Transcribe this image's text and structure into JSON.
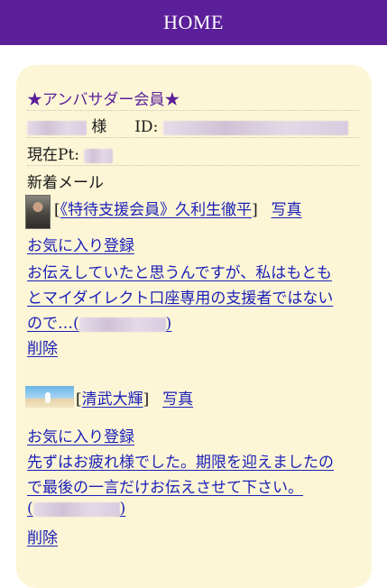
{
  "header": {
    "title": "HOME"
  },
  "profile": {
    "rank_label": "★アンバサダー会員★",
    "name_suffix": "様",
    "id_label": "ID:",
    "points_label": "現在Pt:"
  },
  "mail": {
    "section_label": "新着メール",
    "items": [
      {
        "sender": "《特待支援会員》久利生徹平",
        "photo_link": "写真",
        "favorite_link": "お気に入り登録",
        "message_lines": [
          "お伝えしていたと思うんですが、私はもとも",
          "とマイダイレクト口座専用の支援者ではない",
          "ので…("
        ],
        "message_tail": ")",
        "delete_link": "削除"
      },
      {
        "sender": "清武大輝",
        "photo_link": "写真",
        "favorite_link": "お気に入り登録",
        "message_lines": [
          "先ずはお疲れ様でした。期限を迎えましたの",
          "で最後の一言だけお伝えさせて下さい。",
          "("
        ],
        "message_tail": ")",
        "delete_link": "削除"
      }
    ]
  },
  "colors": {
    "header_bg": "#5c1f9a",
    "card_bg": "#fdf6d6",
    "link": "#1a1fb8",
    "accent_text": "#5c1f9a"
  }
}
